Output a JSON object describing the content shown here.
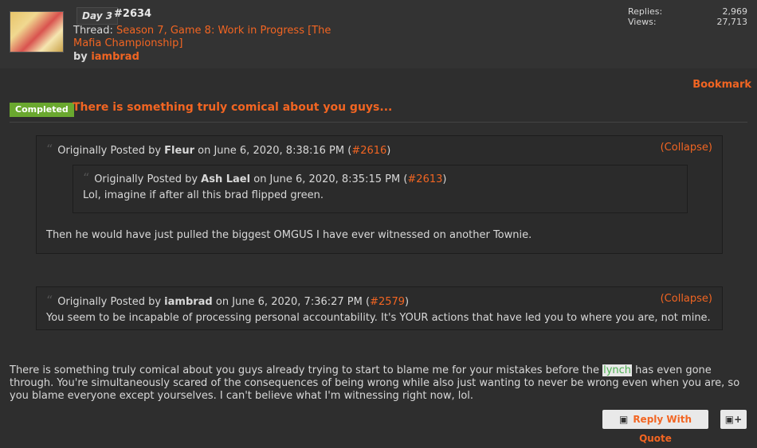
{
  "header": {
    "day": "Day 3",
    "post_number": "#2634",
    "thread_label": "Thread:",
    "thread_title": "Season 7, Game 8: Work in Progress [The Mafia Championship]",
    "by_label": "by",
    "author": "iambrad",
    "replies_label": "Replies:",
    "replies_value": "2,969",
    "views_label": "Views:",
    "views_value": "27,713"
  },
  "bookmark_label": "Bookmark",
  "post": {
    "status_badge": "Completed",
    "title": "There is something truly comical about you guys...",
    "body_before": "There is something truly comical about you guys already trying to start to blame me for your mistakes before the ",
    "body_highlight": "lynch",
    "body_after": " has even gone through. You're simultaneously scared of the consequences of being wrong while also just wanting to never be wrong even when you are, so you blame everyone except yourselves. I can't believe what I'm witnessing right now, lol."
  },
  "quotes": {
    "q1": {
      "prefix": "Originally Posted by",
      "author": "Fleur",
      "date_text": "on June 6, 2020, 8:38:16 PM (",
      "post_link": "#2616",
      "close_paren": ")",
      "collapse": "(Collapse)",
      "body": "Then he would have just pulled the biggest OMGUS I have ever witnessed on another Townie."
    },
    "q1_nested": {
      "prefix": "Originally Posted by",
      "author": "Ash Lael",
      "date_text": "on June 6, 2020, 8:35:15 PM (",
      "post_link": "#2613",
      "close_paren": ")",
      "body": "Lol, imagine if after all this brad flipped green."
    },
    "q2": {
      "prefix": "Originally Posted by",
      "author": "iambrad",
      "date_text": "on June 6, 2020, 7:36:27 PM (",
      "post_link": "#2579",
      "close_paren": ")",
      "collapse": "(Collapse)",
      "body": "You seem to be incapable of processing personal accountability. It's YOUR actions that have led you to where you are, not mine."
    }
  },
  "actions": {
    "reply_with_quote": "Reply With Quote",
    "multi_quote_icon": "multi-quote-icon"
  },
  "colors": {
    "accent": "#f26522",
    "completed": "#6aa82f",
    "background": "#2e2e2e"
  }
}
